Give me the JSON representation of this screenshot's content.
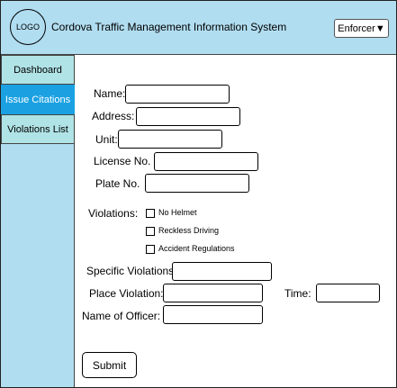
{
  "header": {
    "logo_text": "LOGO",
    "title": "Cordova Traffic Management Information System",
    "role_select": "Enforcer▼"
  },
  "sidebar": {
    "items": [
      {
        "label": "Dashboard",
        "active": false
      },
      {
        "label": "Issue Citations",
        "active": true
      },
      {
        "label": "Violations List",
        "active": false
      }
    ]
  },
  "form": {
    "name_label": "Name:",
    "address_label": "Address:",
    "unit_label": "Unit:",
    "license_label": "License No.",
    "plate_label": "Plate No.",
    "violations_label": "Violations:",
    "violation_options": [
      "No Helmet",
      "Reckless Driving",
      "Accident Regulations"
    ],
    "specific_label": "Specific Violations:",
    "place_label": "Place Violation:",
    "time_label": "Time:",
    "officer_label": "Name of Officer:",
    "submit_label": "Submit"
  },
  "colors": {
    "header_bg": "#b1ddf0",
    "sidebar_bg": "#b1ddf0",
    "tab_bg": "#b0e3e6",
    "active_tab_bg": "#1ba1e2",
    "active_tab_text": "#ffffff"
  }
}
